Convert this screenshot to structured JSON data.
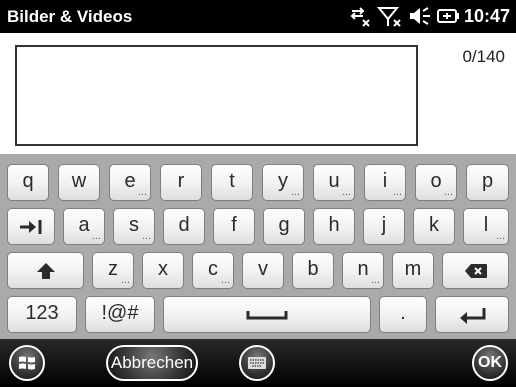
{
  "status_bar": {
    "title": "Bilder & Videos",
    "time": "10:47",
    "icons": [
      "data-connection-off-icon",
      "signal-off-icon",
      "volume-icon",
      "battery-charging-icon"
    ]
  },
  "compose": {
    "char_counter": "0/140"
  },
  "keyboard": {
    "row1": [
      {
        "label": "q"
      },
      {
        "label": "w"
      },
      {
        "label": "e",
        "more": "..."
      },
      {
        "label": "r"
      },
      {
        "label": "t"
      },
      {
        "label": "y",
        "more": "..."
      },
      {
        "label": "u",
        "more": "..."
      },
      {
        "label": "i",
        "more": "..."
      },
      {
        "label": "o",
        "more": "..."
      },
      {
        "label": "p"
      }
    ],
    "row2": [
      {
        "label": "a",
        "more": "..."
      },
      {
        "label": "s",
        "more": "..."
      },
      {
        "label": "d"
      },
      {
        "label": "f"
      },
      {
        "label": "g"
      },
      {
        "label": "h"
      },
      {
        "label": "j"
      },
      {
        "label": "k"
      },
      {
        "label": "l",
        "more": "..."
      }
    ],
    "row3": [
      {
        "label": "z",
        "more": "..."
      },
      {
        "label": "x"
      },
      {
        "label": "c",
        "more": "..."
      },
      {
        "label": "v"
      },
      {
        "label": "b"
      },
      {
        "label": "n",
        "more": "..."
      },
      {
        "label": "m"
      }
    ],
    "numbers_label": "123",
    "symbols_label": "!@#",
    "period_label": ".",
    "tab_icon": "tab-icon",
    "shift_icon": "shift-arrow-icon",
    "backspace_icon": "backspace-icon",
    "space_icon": "space-bar-icon",
    "enter_icon": "enter-icon"
  },
  "bottom_bar": {
    "start_icon": "windows-logo-icon",
    "cancel_label": "Abbrechen",
    "keyboard_icon": "keyboard-icon",
    "ok_label": "OK"
  }
}
